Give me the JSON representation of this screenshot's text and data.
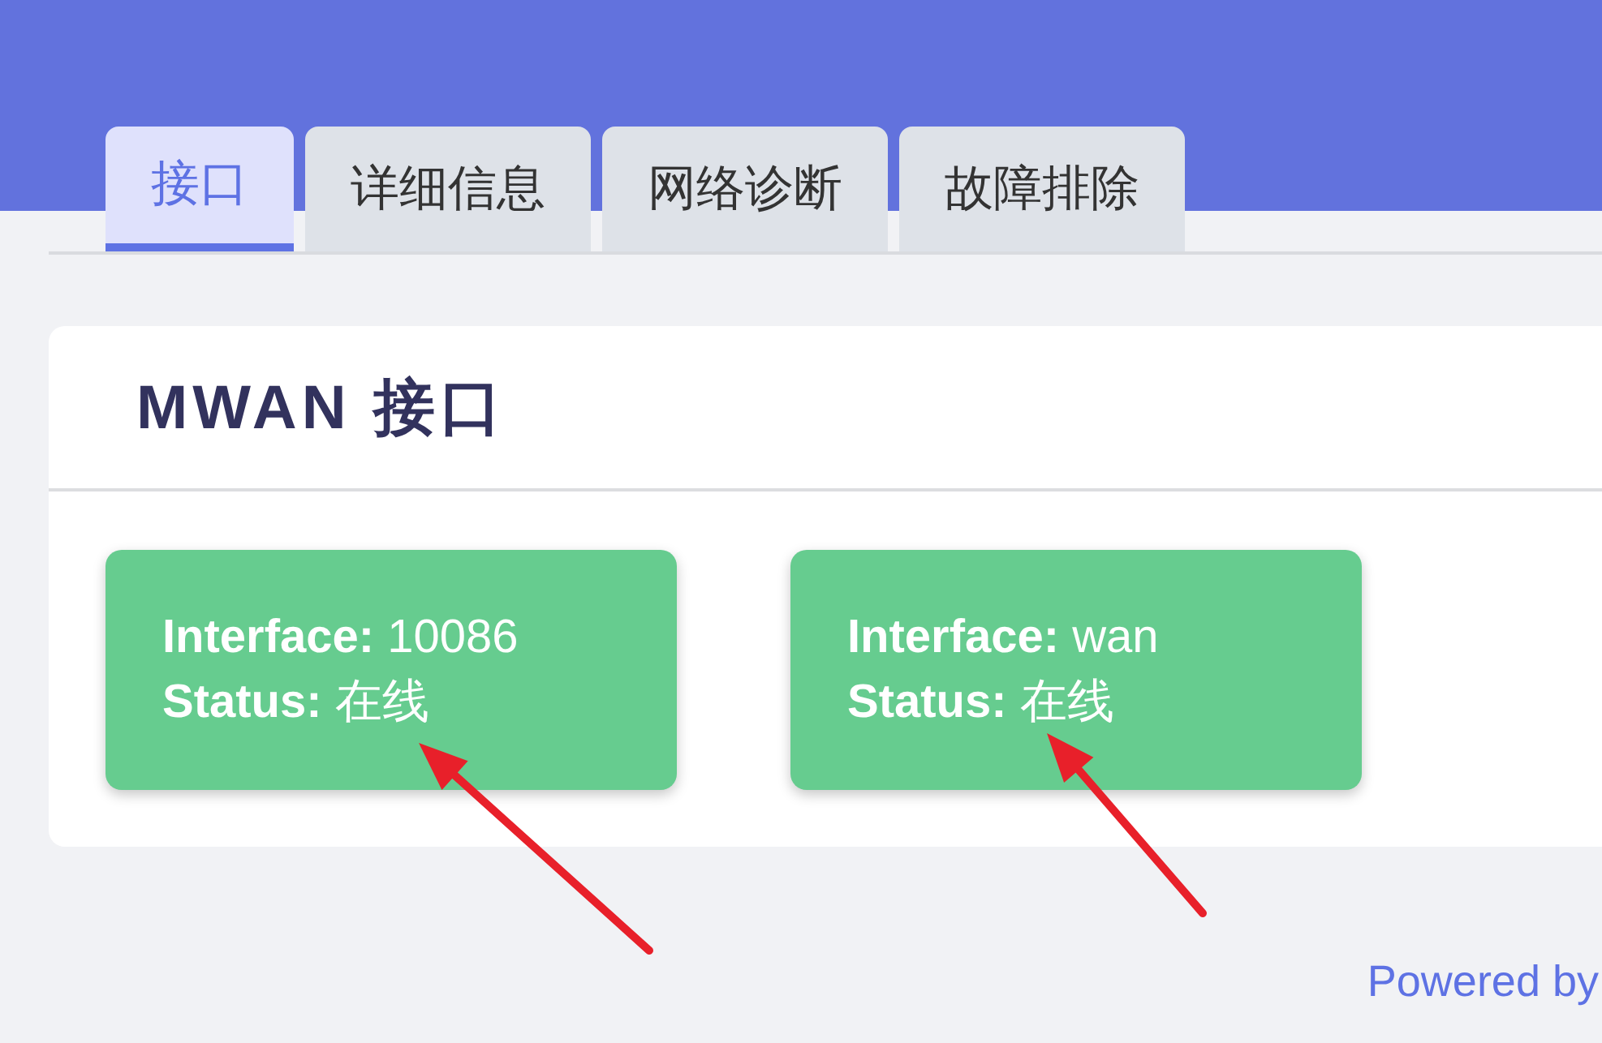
{
  "tabs": [
    {
      "label": "接口",
      "selected": true
    },
    {
      "label": "详细信息",
      "selected": false
    },
    {
      "label": "网络诊断",
      "selected": false
    },
    {
      "label": "故障排除",
      "selected": false
    }
  ],
  "section": {
    "title": "MWAN 接口",
    "interfaces": [
      {
        "interface_label": "Interface:",
        "interface": "10086",
        "status_label": "Status:",
        "status": "在线",
        "arrow_marked": true
      },
      {
        "interface_label": "Interface:",
        "interface": "wan",
        "status_label": "Status:",
        "status": "在线",
        "arrow_marked": true
      }
    ]
  },
  "footer": {
    "text": "Powered by"
  }
}
